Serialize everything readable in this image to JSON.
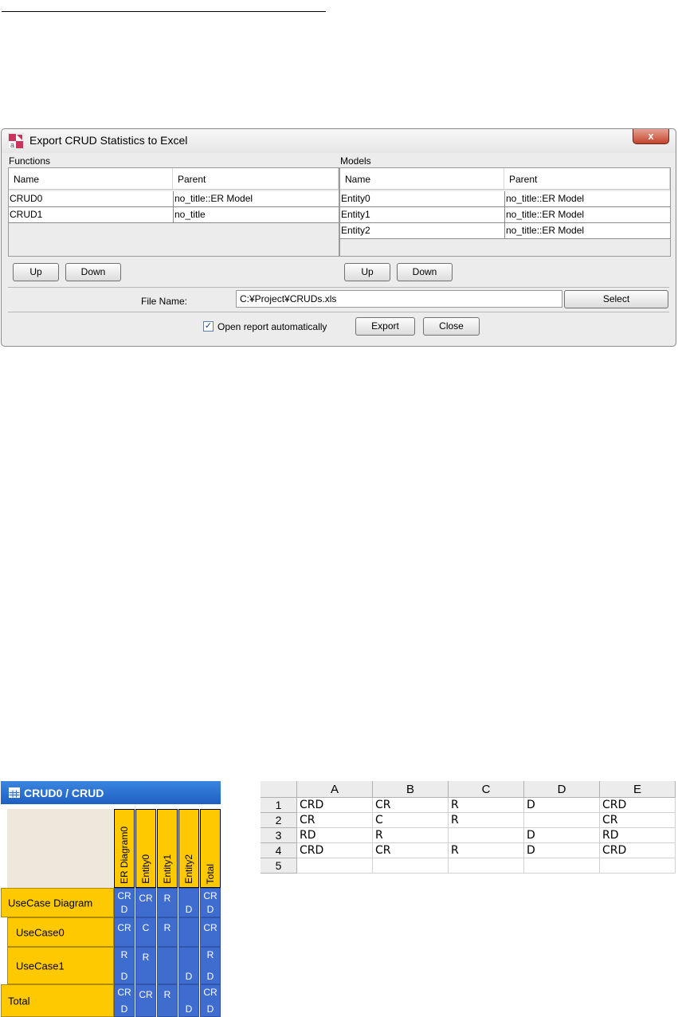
{
  "dialog": {
    "title": "Export CRUD Statistics to Excel",
    "close_symbol": "x",
    "functions": {
      "section_label": "Functions",
      "columns": [
        "Name",
        "Parent"
      ],
      "rows": [
        {
          "name": "CRUD0",
          "parent": "no_title::ER Model"
        },
        {
          "name": "CRUD1",
          "parent": "no_title"
        }
      ],
      "up_label": "Up",
      "down_label": "Down"
    },
    "models": {
      "section_label": "Models",
      "columns": [
        "Name",
        "Parent"
      ],
      "rows": [
        {
          "name": "Entity0",
          "parent": "no_title::ER Model"
        },
        {
          "name": "Entity1",
          "parent": "no_title::ER Model"
        },
        {
          "name": "Entity2",
          "parent": "no_title::ER Model"
        }
      ],
      "up_label": "Up",
      "down_label": "Down"
    },
    "file_name_label": "File Name:",
    "file_name_value": "C:¥Project¥CRUDs.xls",
    "select_label": "Select",
    "open_report_label": "Open report automatically",
    "open_report_checked": true,
    "export_label": "Export",
    "close_label": "Close"
  },
  "crud_matrix": {
    "title": "CRUD0 / CRUD",
    "columns": [
      "ER Diagram0",
      "Entity0",
      "Entity1",
      "Entity2",
      "Total"
    ],
    "rows": [
      {
        "label": "UseCase Diagram",
        "cells": [
          [
            "CR",
            "D"
          ],
          [
            "CR",
            ""
          ],
          [
            "R",
            ""
          ],
          [
            "",
            "D"
          ],
          [
            "CR",
            "D"
          ]
        ]
      },
      {
        "label": "UseCase0",
        "cells": [
          [
            "CR",
            ""
          ],
          [
            "C",
            ""
          ],
          [
            "R",
            ""
          ],
          [
            "",
            ""
          ],
          [
            "CR",
            ""
          ]
        ]
      },
      {
        "label": "UseCase1",
        "cells": [
          [
            "R",
            "D"
          ],
          [
            "R",
            ""
          ],
          [
            "",
            ""
          ],
          [
            "",
            "D"
          ],
          [
            "R",
            "D"
          ]
        ]
      },
      {
        "label": "Total",
        "cells": [
          [
            "CR",
            "D"
          ],
          [
            "CR",
            ""
          ],
          [
            "R",
            ""
          ],
          [
            "",
            "D"
          ],
          [
            "CR",
            "D"
          ]
        ]
      }
    ],
    "colors": {
      "header": "#ffc900",
      "cell": "#3f6ccf",
      "title_bar": "#2a72d4"
    }
  },
  "spreadsheet": {
    "columns": [
      "A",
      "B",
      "C",
      "D",
      "E"
    ],
    "rows": [
      {
        "num": "1",
        "cells": [
          "CRD",
          "CR",
          "R",
          "D",
          "CRD"
        ]
      },
      {
        "num": "2",
        "cells": [
          "CR",
          "C",
          "R",
          "",
          "CR"
        ]
      },
      {
        "num": "3",
        "cells": [
          "RD",
          "R",
          "",
          "D",
          "RD"
        ]
      },
      {
        "num": "4",
        "cells": [
          "CRD",
          "CR",
          "R",
          "D",
          "CRD"
        ]
      },
      {
        "num": "5",
        "cells": [
          "",
          "",
          "",
          "",
          ""
        ]
      }
    ]
  }
}
